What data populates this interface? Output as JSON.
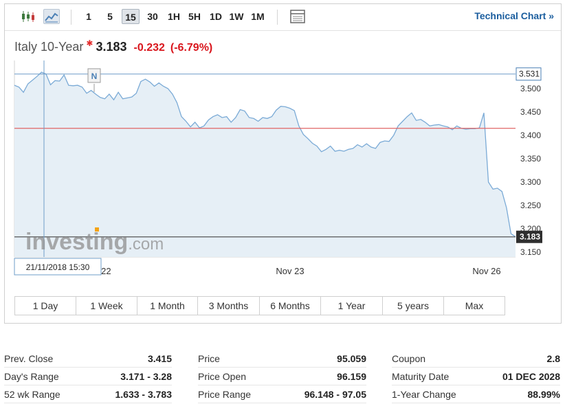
{
  "toolbar": {
    "intervals": [
      "1",
      "5",
      "15",
      "30",
      "1H",
      "5H",
      "1D",
      "1W",
      "1M"
    ],
    "selected_interval": "15",
    "technical_chart_label": "Technical Chart »"
  },
  "quote": {
    "name": "Italy 10-Year",
    "price": "3.183",
    "change": "-0.232",
    "change_pct": "(-6.79%)"
  },
  "colors": {
    "line": "#7aaad6",
    "area": "#e6eff6",
    "prev_close_line": "#e06464",
    "current_line": "#555555",
    "negative": "#d9161d",
    "link": "#1a5d9e"
  },
  "chart_data": {
    "type": "area",
    "ylim": [
      3.14,
      3.56
    ],
    "y_ticks": [
      "3.500",
      "3.450",
      "3.400",
      "3.350",
      "3.300",
      "3.250",
      "3.200",
      "3.150"
    ],
    "x_ticks": [
      "Nov 22",
      "Nov 23",
      "Nov 26"
    ],
    "values": [
      3.507,
      3.503,
      3.492,
      3.51,
      3.518,
      3.526,
      3.535,
      3.531,
      3.508,
      3.517,
      3.516,
      3.529,
      3.507,
      3.506,
      3.507,
      3.503,
      3.49,
      3.496,
      3.488,
      3.481,
      3.478,
      3.488,
      3.476,
      3.492,
      3.478,
      3.48,
      3.482,
      3.49,
      3.515,
      3.52,
      3.514,
      3.505,
      3.512,
      3.505,
      3.5,
      3.488,
      3.47,
      3.44,
      3.43,
      3.418,
      3.428,
      3.416,
      3.42,
      3.433,
      3.44,
      3.444,
      3.438,
      3.44,
      3.428,
      3.438,
      3.455,
      3.452,
      3.438,
      3.436,
      3.43,
      3.438,
      3.436,
      3.44,
      3.454,
      3.462,
      3.461,
      3.458,
      3.453,
      3.42,
      3.402,
      3.393,
      3.383,
      3.377,
      3.365,
      3.37,
      3.377,
      3.366,
      3.368,
      3.366,
      3.37,
      3.372,
      3.38,
      3.375,
      3.382,
      3.375,
      3.372,
      3.385,
      3.388,
      3.387,
      3.4,
      3.42,
      3.43,
      3.44,
      3.448,
      3.432,
      3.434,
      3.428,
      3.42,
      3.422,
      3.423,
      3.42,
      3.418,
      3.412,
      3.42,
      3.415,
      3.413,
      3.414,
      3.414,
      3.416,
      3.448,
      3.3,
      3.285,
      3.287,
      3.28,
      3.245,
      3.19,
      3.183
    ],
    "prev_close": 3.415,
    "last_price": "3.183",
    "high_marker": "3.531",
    "crosshair_date": "21/11/2018 15:30",
    "event_flag": "N"
  },
  "range_buttons": [
    "1 Day",
    "1 Week",
    "1 Month",
    "3 Months",
    "6 Months",
    "1 Year",
    "5 years",
    "Max"
  ],
  "watermark": {
    "brand": "investing",
    "suffix": ".com"
  },
  "stats": {
    "col1": [
      {
        "label": "Prev. Close",
        "value": "3.415"
      },
      {
        "label": "Day's Range",
        "value": "3.171 - 3.28"
      },
      {
        "label": "52 wk Range",
        "value": "1.633 - 3.783"
      }
    ],
    "col2": [
      {
        "label": "Price",
        "value": "95.059"
      },
      {
        "label": "Price Open",
        "value": "96.159"
      },
      {
        "label": "Price Range",
        "value": "96.148 - 97.05"
      }
    ],
    "col3": [
      {
        "label": "Coupon",
        "value": "2.8"
      },
      {
        "label": "Maturity Date",
        "value": "01 DEC 2028"
      },
      {
        "label": "1-Year Change",
        "value": "88.99%"
      }
    ]
  }
}
